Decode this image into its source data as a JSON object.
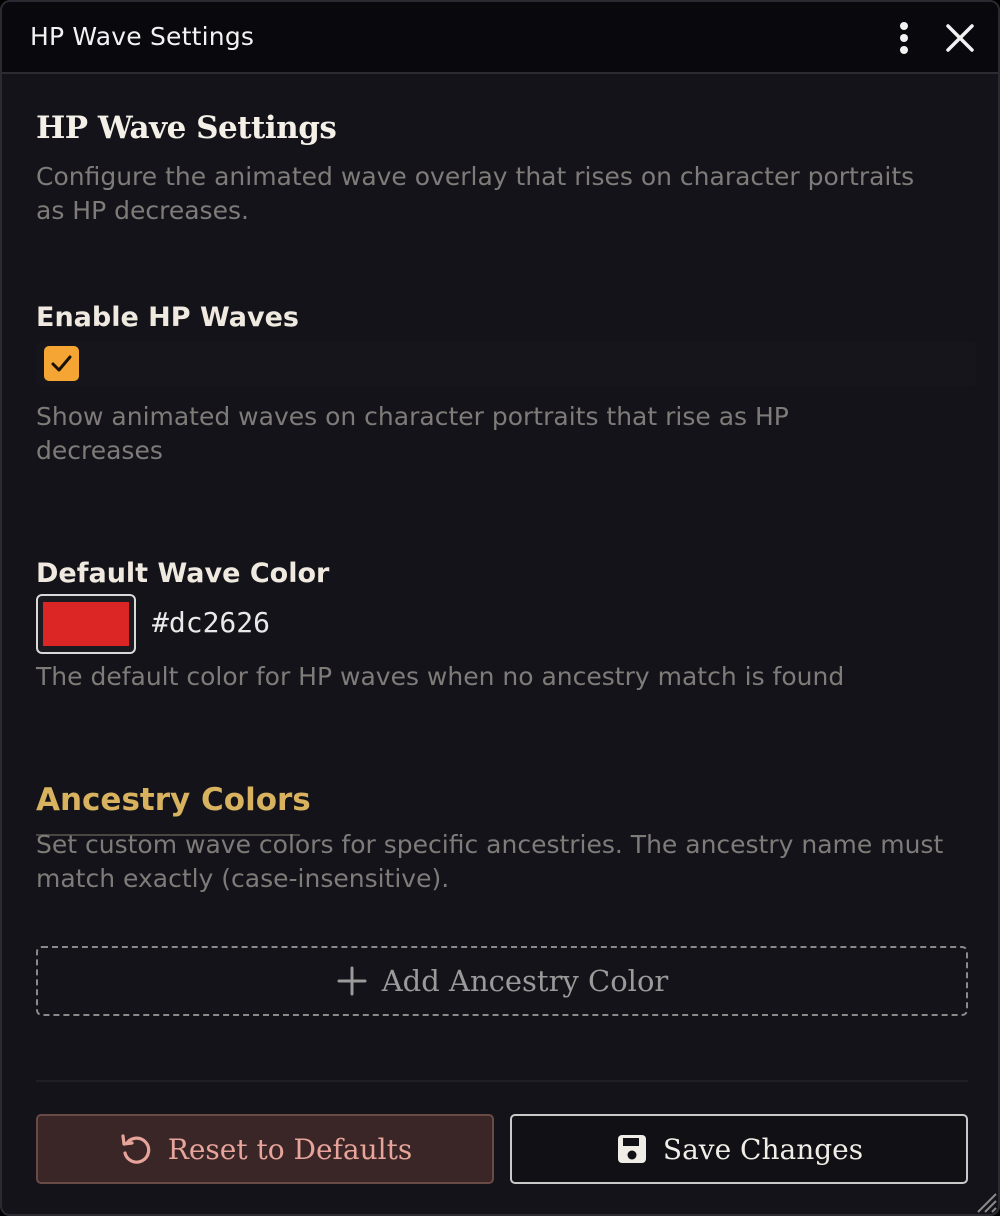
{
  "window": {
    "title": "HP Wave Settings",
    "menu_icon": "kebab-icon",
    "close_icon": "close-icon"
  },
  "main": {
    "heading": "HP Wave Settings",
    "intro": "Configure the animated wave overlay that rises on character portraits as HP decreases."
  },
  "enable": {
    "label": "Enable HP Waves",
    "checked": true,
    "hint": "Show animated waves on character portraits that rise as HP decreases"
  },
  "default_color": {
    "label": "Default Wave Color",
    "value": "#dc2626",
    "hint": "The default color for HP waves when no ancestry match is found"
  },
  "ancestry": {
    "title": "Ancestry Colors",
    "description": "Set custom wave colors for specific ancestries. The ancestry name must match exactly (case-insensitive).",
    "add_label": "Add Ancestry Color"
  },
  "footer": {
    "reset_label": "Reset to Defaults",
    "save_label": "Save Changes"
  },
  "colors": {
    "accent_checkbox": "#f4a533",
    "section_title": "#d8b25e",
    "reset_text": "#e7a49a",
    "wave_default": "#dc2626"
  }
}
